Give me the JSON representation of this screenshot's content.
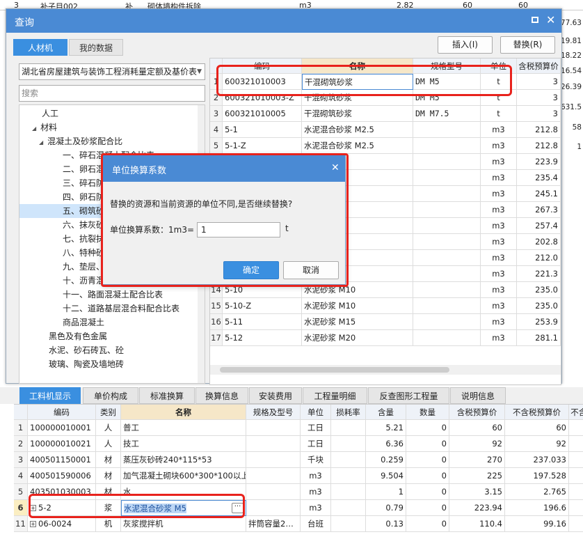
{
  "bg_top": {
    "cells": [
      "3",
      "补子目002",
      "补",
      "砌体墙构件拆除",
      "m3",
      "2.82",
      "60",
      "60"
    ]
  },
  "bg_right_values": [
    "177.63",
    "119.81",
    "18.22",
    "16.54",
    "26.39",
    "631.5",
    "58",
    "1"
  ],
  "dialog": {
    "title": "查询",
    "tabs": [
      "人材机",
      "我的数据"
    ],
    "insert_button": "插入(I)",
    "replace_button": "替换(R)",
    "combo_value": "湖北省房屋建筑与装饰工程消耗量定额及基价表",
    "search_placeholder": "搜索",
    "tree": [
      {
        "label": "人工",
        "level": 1
      },
      {
        "label": "材料",
        "level": 1
      },
      {
        "label": "混凝土及砂浆配合比",
        "level": 2
      },
      {
        "label": "一、碎石混凝土配合比表",
        "level": 3
      },
      {
        "label": "二、卵石混",
        "level": 3
      },
      {
        "label": "三、碎石防",
        "level": 3
      },
      {
        "label": "四、卵石防",
        "level": 3
      },
      {
        "label": "五、砌筑砂",
        "level": 3
      },
      {
        "label": "六、抹灰砂",
        "level": 3
      },
      {
        "label": "七、抗裂抹",
        "level": 3
      },
      {
        "label": "八、特种砂",
        "level": 3
      },
      {
        "label": "九、垫层、",
        "level": 3
      },
      {
        "label": "十、沥青混",
        "level": 3
      },
      {
        "label": "十一、路面混凝土配合比表",
        "level": 3
      },
      {
        "label": "十二、道路基层混合料配合比表",
        "level": 3
      },
      {
        "label": "商品混凝土",
        "level": 3
      },
      {
        "label": "黑色及有色金属",
        "level": 2
      },
      {
        "label": "水泥、砂石砖瓦、砼",
        "level": 2
      },
      {
        "label": "玻璃、陶瓷及墙地砖",
        "level": 2
      }
    ],
    "grid_headers": [
      "编码",
      "名称",
      "规格型号",
      "单位",
      "含税预算价"
    ],
    "grid_rows": [
      {
        "n": "1",
        "code": "600321010003",
        "name": "干混砌筑砂浆",
        "spec": "DM M5",
        "unit": "t",
        "price": "3"
      },
      {
        "n": "2",
        "code": "600321010003-Z",
        "name": "干混砌筑砂浆",
        "spec": "DM M5",
        "unit": "t",
        "price": "3"
      },
      {
        "n": "3",
        "code": "600321010005",
        "name": "干混砌筑砂浆",
        "spec": "DM M7.5",
        "unit": "t",
        "price": "3"
      },
      {
        "n": "4",
        "code": "5-1",
        "name": "水泥混合砂浆 M2.5",
        "spec": "",
        "unit": "m3",
        "price": "212.8"
      },
      {
        "n": "5",
        "code": "5-1-Z",
        "name": "水泥混合砂浆 M2.5",
        "spec": "",
        "unit": "m3",
        "price": "212.8"
      },
      {
        "n": "6",
        "code": "",
        "name": "M5",
        "spec": "",
        "unit": "m3",
        "price": "223.9"
      },
      {
        "n": "7",
        "code": "",
        "name": "M7.5",
        "spec": "",
        "unit": "m3",
        "price": "235.4"
      },
      {
        "n": "8",
        "code": "",
        "name": "M10",
        "spec": "",
        "unit": "m3",
        "price": "245.1"
      },
      {
        "n": "9",
        "code": "",
        "name": "M15",
        "spec": "",
        "unit": "m3",
        "price": "267.3"
      },
      {
        "n": "10",
        "code": "",
        "name": "M20",
        "spec": "",
        "unit": "m3",
        "price": "257.4"
      },
      {
        "n": "11",
        "code": "",
        "name": "5",
        "spec": "",
        "unit": "m3",
        "price": "202.8"
      },
      {
        "n": "12",
        "code": "",
        "name": "",
        "spec": "",
        "unit": "m3",
        "price": "212.0"
      },
      {
        "n": "13",
        "code": "",
        "name": "5",
        "spec": "",
        "unit": "m3",
        "price": "221.3"
      },
      {
        "n": "14",
        "code": "5-10",
        "name": "水泥砂浆 M10",
        "spec": "",
        "unit": "m3",
        "price": "235.0"
      },
      {
        "n": "15",
        "code": "5-10-Z",
        "name": "水泥砂浆 M10",
        "spec": "",
        "unit": "m3",
        "price": "235.0"
      },
      {
        "n": "16",
        "code": "5-11",
        "name": "水泥砂浆 M15",
        "spec": "",
        "unit": "m3",
        "price": "253.9"
      },
      {
        "n": "17",
        "code": "5-12",
        "name": "水泥砂浆 M20",
        "spec": "",
        "unit": "m3",
        "price": "281.1"
      }
    ]
  },
  "modal": {
    "title": "单位换算系数",
    "message": "替换的资源和当前资源的单位不同,是否继续替换?",
    "label": "单位换算系数：1m3=",
    "value": "1",
    "unit": "t",
    "ok": "确定",
    "cancel": "取消"
  },
  "bottom": {
    "tabs": [
      "工料机显示",
      "单价构成",
      "标准换算",
      "换算信息",
      "安装费用",
      "工程量明细",
      "反查图形工程量",
      "说明信息"
    ],
    "headers": [
      "编码",
      "类别",
      "名称",
      "规格及型号",
      "单位",
      "损耗率",
      "含量",
      "数量",
      "含税预算价",
      "不含税预算价",
      "不含税"
    ],
    "rows": [
      {
        "n": "1",
        "code": "100000010001",
        "cat": "人",
        "name": "普工",
        "spec": "",
        "unit": "工日",
        "loss": "",
        "qty": "5.21",
        "amt": "0",
        "p1": "60",
        "p2": "60",
        "p3": ""
      },
      {
        "n": "2",
        "code": "100000010021",
        "cat": "人",
        "name": "技工",
        "spec": "",
        "unit": "工日",
        "loss": "",
        "qty": "6.36",
        "amt": "0",
        "p1": "92",
        "p2": "92",
        "p3": ""
      },
      {
        "n": "3",
        "code": "400501150001",
        "cat": "材",
        "name": "蒸压灰砂砖240*115*53",
        "spec": "",
        "unit": "千块",
        "loss": "",
        "qty": "0.259",
        "amt": "0",
        "p1": "270",
        "p2": "237.033",
        "p3": "2"
      },
      {
        "n": "4",
        "code": "400501590006",
        "cat": "材",
        "name": "加气混凝土砌块600*300*100以上",
        "spec": "",
        "unit": "m3",
        "loss": "",
        "qty": "9.504",
        "amt": "0",
        "p1": "225",
        "p2": "197.528",
        "p3": ""
      },
      {
        "n": "5",
        "code": "403501030003",
        "cat": "材",
        "name": "水",
        "spec": "",
        "unit": "m3",
        "loss": "",
        "qty": "1",
        "amt": "0",
        "p1": "3.15",
        "p2": "2.765",
        "p3": ""
      },
      {
        "n": "6",
        "code": "5-2",
        "cat": "浆",
        "name": "水泥混合砂浆 M5",
        "spec": "",
        "unit": "m3",
        "loss": "",
        "qty": "0.79",
        "amt": "0",
        "p1": "223.94",
        "p2": "196.6",
        "p3": ""
      },
      {
        "n": "11",
        "code": "06-0024",
        "cat": "机",
        "name": "灰浆搅拌机",
        "spec": "拌筒容量2…",
        "unit": "台班",
        "loss": "",
        "qty": "0.13",
        "amt": "0",
        "p1": "110.4",
        "p2": "99.16",
        "p3": ""
      }
    ]
  }
}
